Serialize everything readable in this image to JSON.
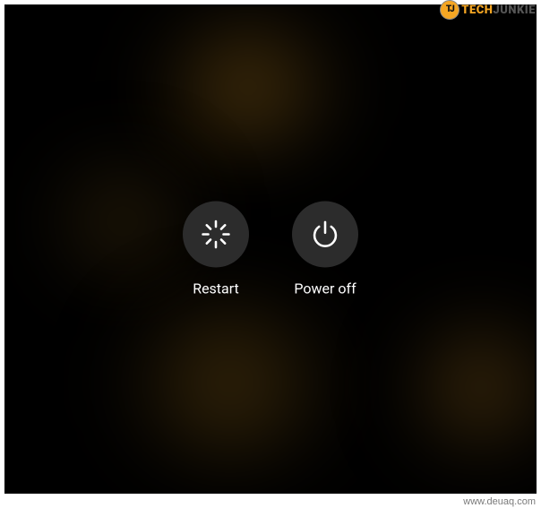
{
  "watermark": {
    "badge_text": "TJ",
    "brand_part1": "TECH",
    "brand_part2": "JUNKIE",
    "url": "www.deuaq.com"
  },
  "power_menu": {
    "restart": {
      "label": "Restart",
      "icon": "restart-spinner-icon"
    },
    "power_off": {
      "label": "Power off",
      "icon": "power-icon"
    }
  },
  "colors": {
    "accent": "#f5a623",
    "button_bg": "#2c2c2c",
    "text": "#ffffff"
  }
}
